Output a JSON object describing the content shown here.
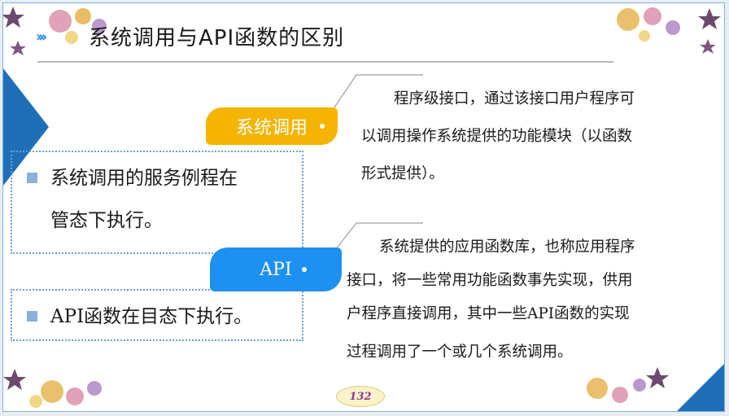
{
  "slide": {
    "title": "系统调用与API函数的区别",
    "page_number": "132"
  },
  "left_points": [
    {
      "line1": "系统调用的服务例程在",
      "line2": "管态下执行。"
    },
    {
      "line1": "API函数在目态下执行。"
    }
  ],
  "badges": {
    "syscall": "系统调用",
    "api": "API"
  },
  "descriptions": {
    "syscall_lines": [
      "程序级接口，通过该接口用户程序可",
      "以调用操作系统提供的功能模块（以函数",
      "形式提供）。"
    ],
    "api_lines": [
      "系统提供的应用函数库，也称应用程序",
      "接口，将一些常用功能函数事先实现，供用",
      "户程序直接调用，其中一些API函数的实现",
      "过程调用了一个或几个系统调用。"
    ]
  },
  "colors": {
    "accent_blue": "#1e6fb8",
    "badge_yellow": "#f4b400",
    "badge_blue": "#1e90f0",
    "bullet": "#8ab0dc"
  }
}
